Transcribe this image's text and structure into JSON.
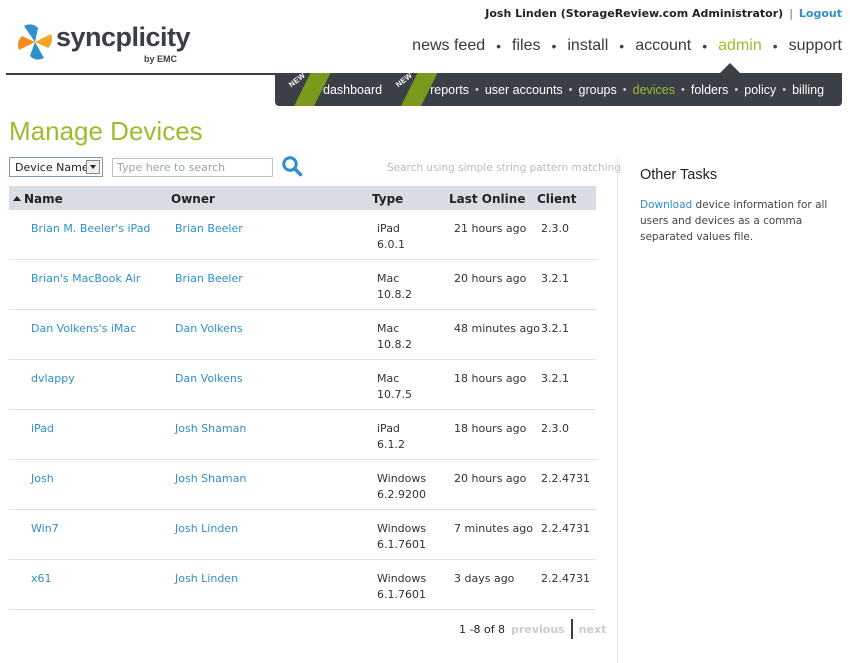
{
  "header": {
    "logo_text": "syncplicity",
    "logo_byline": "by EMC",
    "user_label": "Josh Linden (StorageReview.com Administrator)",
    "separator": "|",
    "logout_label": "Logout"
  },
  "main_nav": [
    {
      "label": "news feed",
      "active": false
    },
    {
      "label": "files",
      "active": false
    },
    {
      "label": "install",
      "active": false
    },
    {
      "label": "account",
      "active": false
    },
    {
      "label": "admin",
      "active": true
    },
    {
      "label": "support",
      "active": false
    }
  ],
  "sub_nav": {
    "new_badge": "NEW",
    "items": [
      {
        "label": "dashboard",
        "new": true,
        "active": false
      },
      {
        "label": "reports",
        "new": true,
        "active": false
      },
      {
        "label": "user accounts",
        "new": false,
        "active": false
      },
      {
        "label": "groups",
        "new": false,
        "active": false
      },
      {
        "label": "devices",
        "new": false,
        "active": true
      },
      {
        "label": "folders",
        "new": false,
        "active": false
      },
      {
        "label": "policy",
        "new": false,
        "active": false
      },
      {
        "label": "billing",
        "new": false,
        "active": false
      }
    ]
  },
  "page": {
    "title": "Manage Devices"
  },
  "filter": {
    "selected": "Device Name",
    "search_placeholder": "Type here to search",
    "hint": "Search using simple string pattern matching"
  },
  "table": {
    "columns": [
      "Name",
      "Owner",
      "Type",
      "Last Online",
      "Client"
    ],
    "rows": [
      {
        "name": "Brian M. Beeler's iPad",
        "owner": "Brian Beeler",
        "type": "iPad",
        "version": "6.0.1",
        "last_online": "21 hours ago",
        "client": "2.3.0"
      },
      {
        "name": "Brian's MacBook Air",
        "owner": "Brian Beeler",
        "type": "Mac",
        "version": "10.8.2",
        "last_online": "20 hours ago",
        "client": "3.2.1"
      },
      {
        "name": "Dan Volkens's iMac",
        "owner": "Dan Volkens",
        "type": "Mac",
        "version": "10.8.2",
        "last_online": "48 minutes ago",
        "client": "3.2.1"
      },
      {
        "name": "dvlappy",
        "owner": "Dan Volkens",
        "type": "Mac",
        "version": "10.7.5",
        "last_online": "18 hours ago",
        "client": "3.2.1"
      },
      {
        "name": "iPad",
        "owner": "Josh Shaman",
        "type": "iPad",
        "version": "6.1.2",
        "last_online": "18 hours ago",
        "client": "2.3.0"
      },
      {
        "name": "Josh",
        "owner": "Josh Shaman",
        "type": "Windows",
        "version": "6.2.9200",
        "last_online": "20 hours ago",
        "client": "2.2.4731"
      },
      {
        "name": "Win7",
        "owner": "Josh Linden",
        "type": "Windows",
        "version": "6.1.7601",
        "last_online": "7 minutes ago",
        "client": "2.2.4731"
      },
      {
        "name": "x61",
        "owner": "Josh Linden",
        "type": "Windows",
        "version": "6.1.7601",
        "last_online": "3 days ago",
        "client": "2.2.4731"
      }
    ]
  },
  "pager": {
    "range": "1 -8 of 8",
    "previous": "previous",
    "next": "next"
  },
  "side": {
    "title": "Other Tasks",
    "link": "Download",
    "text": " device information for all users and devices as a comma separated values file."
  },
  "colors": {
    "accent_green": "#9bbd2e",
    "link_blue": "#2e8fc9",
    "nav_dark": "#3b4046"
  }
}
